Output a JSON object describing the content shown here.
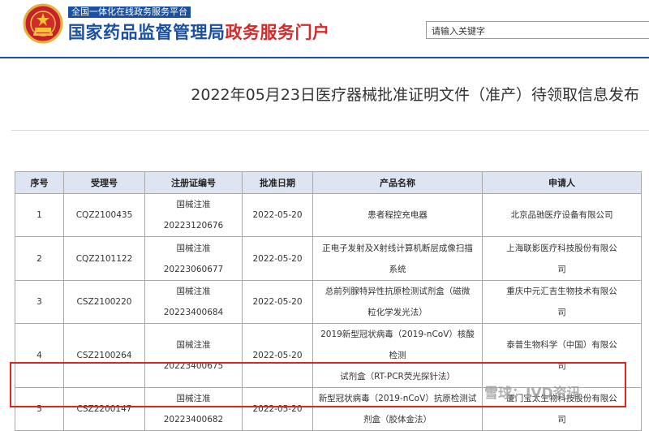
{
  "header": {
    "platform_tag": "全国一体化在线政务服务平台",
    "site_title_main": "国家药品监督管理局",
    "site_title_accent": "政务服务门户",
    "search_placeholder": "请输入关键字",
    "colors": {
      "brand": "#1a4fa3",
      "accent": "#d62a2a"
    }
  },
  "article": {
    "title": "2022年05月23日医疗器械批准证明文件（准产）待领取信息发布"
  },
  "table": {
    "columns": [
      "序号",
      "受理号",
      "注册证编号",
      "批准日期",
      "产品名称",
      "申请人"
    ],
    "rows": [
      {
        "no": "1",
        "accept_no": "CQZ2100435",
        "reg_no": [
          "国械注准",
          "20223120676"
        ],
        "date": "2022-05-20",
        "product": [
          "患者程控充电器"
        ],
        "applicant": [
          "北京品驰医疗设备有限公司"
        ]
      },
      {
        "no": "2",
        "accept_no": "CQZ2101122",
        "reg_no": [
          "国械注准",
          "20223060677"
        ],
        "date": "2022-05-20",
        "product": [
          "正电子发射及X射线计算机断层成像扫描",
          "系统"
        ],
        "applicant": [
          "上海联影医疗科技股份有限公",
          "司"
        ]
      },
      {
        "no": "3",
        "accept_no": "CSZ2100220",
        "reg_no": [
          "国械注准",
          "20223400684"
        ],
        "date": "2022-05-20",
        "product": [
          "总前列腺特异性抗原检测试剂盒（磁微",
          "粒化学发光法）"
        ],
        "applicant": [
          "重庆中元汇吉生物技术有限公",
          "司"
        ]
      },
      {
        "no": "4",
        "accept_no": "CSZ2100264",
        "reg_no": [
          "国械注准",
          "20223400675"
        ],
        "date": "2022-05-20",
        "product": [
          "2019新型冠状病毒（2019-nCoV）核酸检测",
          "试剂盒（RT-PCR荧光探针法）"
        ],
        "applicant": [
          "泰普生物科学（中国）有限公",
          "司"
        ]
      },
      {
        "no": "5",
        "accept_no": "CSZ2200147",
        "reg_no": [
          "国械注准",
          "20223400682"
        ],
        "date": "2022-05-20",
        "product": [
          "新型冠状病毒（2019-nCoV）抗原检测试",
          "剂盒（胶体金法）"
        ],
        "applicant": [
          "厦门宝太生物科技股份有限公",
          "司"
        ]
      }
    ],
    "highlight_color": "#e02424"
  },
  "watermark": "雪球：IVD资讯"
}
